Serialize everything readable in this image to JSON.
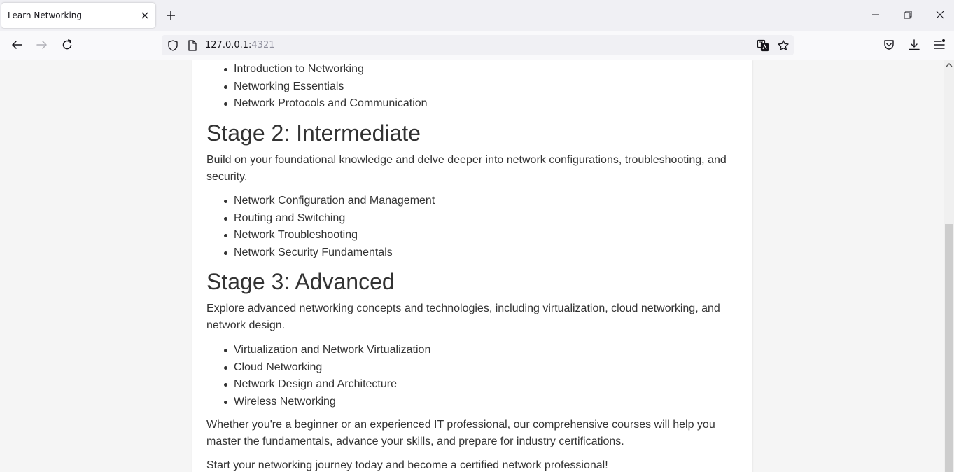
{
  "browser": {
    "tab_title": "Learn Networking",
    "url_host": "127.0.0.1:",
    "url_port": "4321"
  },
  "content": {
    "top_list": [
      "Introduction to Networking",
      "Networking Essentials",
      "Network Protocols and Communication"
    ],
    "stage2": {
      "heading": "Stage 2: Intermediate",
      "description": "Build on your foundational knowledge and delve deeper into network configurations, troubleshooting, and security.",
      "items": [
        "Network Configuration and Management",
        "Routing and Switching",
        "Network Troubleshooting",
        "Network Security Fundamentals"
      ]
    },
    "stage3": {
      "heading": "Stage 3: Advanced",
      "description": "Explore advanced networking concepts and technologies, including virtualization, cloud networking, and network design.",
      "items": [
        "Virtualization and Network Virtualization",
        "Cloud Networking",
        "Network Design and Architecture",
        "Wireless Networking"
      ]
    },
    "closing_paragraph": "Whether you're a beginner or an experienced IT professional, our comprehensive courses will help you master the fundamentals, advance your skills, and prepare for industry certifications.",
    "cta_paragraph": "Start your networking journey today and become a certified network professional!"
  },
  "icons": {
    "back": "back-arrow-icon",
    "forward": "forward-arrow-icon",
    "reload": "reload-icon",
    "shield": "shield-icon",
    "page": "page-icon",
    "translate": "translate-icon",
    "bookmark": "star-icon",
    "pocket": "pocket-icon",
    "downloads": "download-icon",
    "menu": "hamburger-menu-icon"
  },
  "colors": {
    "text": "#333333",
    "page_bg": "#ffffff",
    "viewport_bg": "#f5f5f5"
  }
}
